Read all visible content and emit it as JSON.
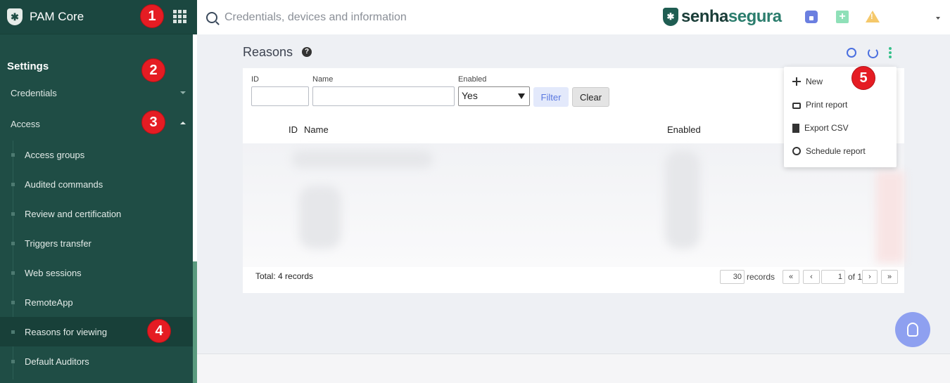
{
  "app": {
    "name": "PAM Core"
  },
  "search": {
    "placeholder": "Credentials, devices and information"
  },
  "brand": {
    "part1": "senha",
    "part2": "segura"
  },
  "sidebar": {
    "heading": "Settings",
    "sections": [
      {
        "label": "Credentials",
        "expanded": false
      },
      {
        "label": "Access",
        "expanded": true
      }
    ],
    "items": [
      {
        "label": "Access groups"
      },
      {
        "label": "Audited commands"
      },
      {
        "label": "Review and certification"
      },
      {
        "label": "Triggers transfer"
      },
      {
        "label": "Web sessions"
      },
      {
        "label": "RemoteApp"
      },
      {
        "label": "Reasons for viewing",
        "active": true
      },
      {
        "label": "Default Auditors"
      }
    ]
  },
  "page": {
    "title": "Reasons"
  },
  "filters": {
    "id_label": "ID",
    "name_label": "Name",
    "enabled_label": "Enabled",
    "enabled_value": "Yes",
    "filter_button": "Filter",
    "clear_button": "Clear"
  },
  "table": {
    "columns": [
      "ID",
      "Name",
      "Enabled"
    ]
  },
  "footer": {
    "total": "Total: 4 records",
    "per_page": "30",
    "records_label": "records",
    "first": "«",
    "prev": "‹",
    "page": "1",
    "of": "of 1",
    "next": "›",
    "last": "»"
  },
  "menu": {
    "items": [
      {
        "label": "New",
        "icon": "plus-icon"
      },
      {
        "label": "Print report",
        "icon": "print-icon"
      },
      {
        "label": "Export CSV",
        "icon": "file-icon"
      },
      {
        "label": "Schedule report",
        "icon": "clock-icon"
      }
    ]
  },
  "badges": [
    "1",
    "2",
    "3",
    "4",
    "5"
  ],
  "colors": {
    "sidebar_bg": "#1f4d45",
    "accent_blue": "#4a6fe0",
    "accent_green": "#36c08a",
    "badge_red": "#e51c23"
  }
}
